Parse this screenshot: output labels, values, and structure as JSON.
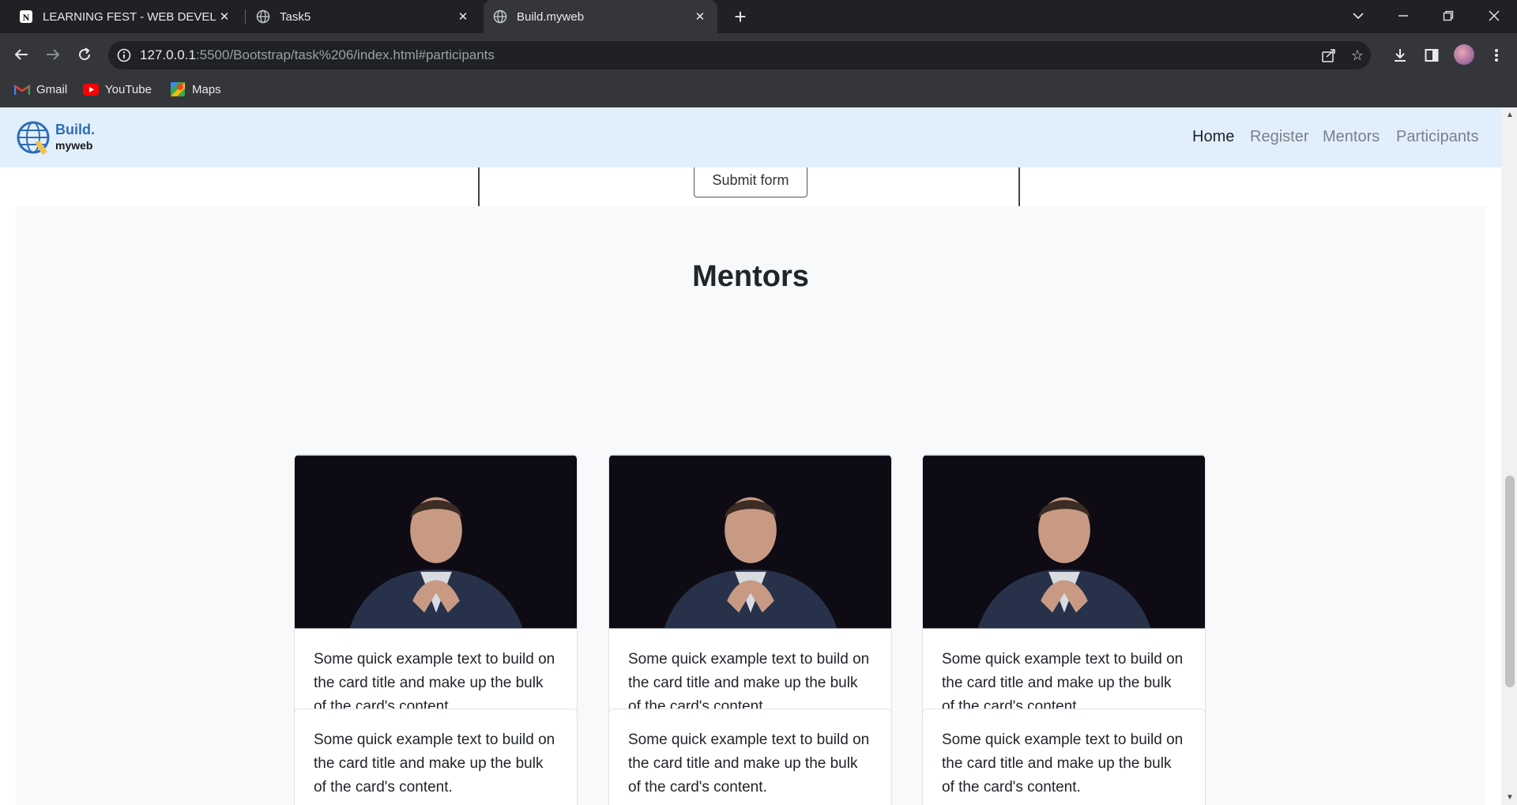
{
  "browser": {
    "tabs": [
      {
        "title": "LEARNING FEST - WEB DEVELOP",
        "favicon": "notion-icon",
        "active": false
      },
      {
        "title": "Task5",
        "favicon": "globe-icon",
        "active": false
      },
      {
        "title": "Build.myweb",
        "favicon": "globe-icon",
        "active": true
      }
    ],
    "url_host": "127.0.0.1",
    "url_rest": ":5500/Bootstrap/task%206/index.html#participants",
    "bookmarks": [
      {
        "label": "Gmail",
        "icon": "gmail-icon"
      },
      {
        "label": "YouTube",
        "icon": "youtube-icon"
      },
      {
        "label": "Maps",
        "icon": "maps-icon"
      }
    ]
  },
  "site": {
    "brand_line1": "Build.",
    "brand_line2": "myweb",
    "nav": [
      "Home",
      "Register",
      "Mentors",
      "Participants"
    ],
    "active_nav": "Home",
    "submit_label": "Submit form",
    "mentors_heading": "Mentors",
    "cards_with_photo": [
      {
        "text": "Some quick example text to build on the card title and make up the bulk of the card's content."
      },
      {
        "text": "Some quick example text to build on the card title and make up the bulk of the card's content."
      },
      {
        "text": "Some quick example text to build on the card title and make up the bulk of the card's content."
      }
    ],
    "cards_text_only": [
      {
        "text": "Some quick example text to build on the card title and make up the bulk of the card's content."
      },
      {
        "text": "Some quick example text to build on the card title and make up the bulk of the card's content."
      },
      {
        "text": "Some quick example text to build on the card title and make up the bulk of the card's content."
      }
    ]
  },
  "colors": {
    "tabbar": "#202124",
    "toolbar": "#35363a",
    "navbar": "#e1effd",
    "section_bg": "#f8f9fa",
    "brand_blue": "#2e6cb5"
  }
}
